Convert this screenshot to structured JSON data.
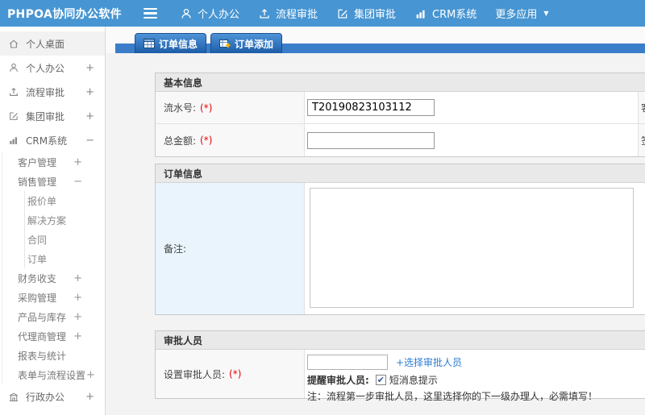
{
  "topbar": {
    "logo": "PHPOA协同办公软件",
    "nav": [
      {
        "label": "个人办公",
        "icon": "person-icon"
      },
      {
        "label": "流程审批",
        "icon": "upload-icon"
      },
      {
        "label": "集团审批",
        "icon": "edit-icon"
      },
      {
        "label": "CRM系统",
        "icon": "chart-icon"
      },
      {
        "label": "更多应用",
        "icon": "caret-down-icon"
      }
    ]
  },
  "sidebar": {
    "items": [
      {
        "label": "个人桌面",
        "icon": "home-icon",
        "expand": ""
      },
      {
        "label": "个人办公",
        "icon": "person-icon",
        "expand": "+"
      },
      {
        "label": "流程审批",
        "icon": "upload-icon",
        "expand": "+"
      },
      {
        "label": "集团审批",
        "icon": "edit-icon",
        "expand": "+"
      },
      {
        "label": "CRM系统",
        "icon": "chart-icon",
        "expand": "−"
      },
      {
        "label": "客户管理",
        "expand": "+"
      },
      {
        "label": "销售管理",
        "expand": "−"
      },
      {
        "label": "报价单",
        "expand": ""
      },
      {
        "label": "解决方案",
        "expand": ""
      },
      {
        "label": "合同",
        "expand": ""
      },
      {
        "label": "订单",
        "expand": ""
      },
      {
        "label": "财务收支",
        "expand": "+"
      },
      {
        "label": "采购管理",
        "expand": "+"
      },
      {
        "label": "产品与库存",
        "expand": "+"
      },
      {
        "label": "代理商管理",
        "expand": "+"
      },
      {
        "label": "报表与统计",
        "expand": ""
      },
      {
        "label": "表单与流程设置",
        "expand": "+"
      },
      {
        "label": "行政办公",
        "icon": "building-icon",
        "expand": "+"
      }
    ]
  },
  "tabs": [
    {
      "label": "订单信息",
      "icon": "table-icon"
    },
    {
      "label": "订单添加",
      "icon": "table-add-icon"
    }
  ],
  "form": {
    "sections": {
      "basic": {
        "title": "基本信息",
        "rows": [
          {
            "label": "流水号:",
            "required": "(*)",
            "value": "T20190823103112",
            "right_label": "客"
          },
          {
            "label": "总金额:",
            "required": "(*)",
            "value": "",
            "right_label": "签"
          }
        ]
      },
      "order": {
        "title": "订单信息",
        "remark_label": "备注:",
        "remark_value": ""
      },
      "approver": {
        "title": "审批人员",
        "label": "设置审批人员:",
        "required": "(*)",
        "input_value": "",
        "choose_link": "+选择审批人员",
        "remind_label": "提醒审批人员:",
        "sms_label": "短消息提示",
        "sms_checked": true,
        "note": "注：流程第一步审批人员，这里选择你的下一级办理人，必需填写！"
      }
    }
  },
  "icons": {
    "checkmark": "✔",
    "caret_down": "▼"
  },
  "colors": {
    "topbar": "#4795d2",
    "tab_strip": "#3a7dc9",
    "tab_face": "#1d5ca8",
    "link": "#2c7cd4",
    "required": "#e60000",
    "remark_cell": "#e9f4fc",
    "section_header": "#e9e9e9"
  }
}
